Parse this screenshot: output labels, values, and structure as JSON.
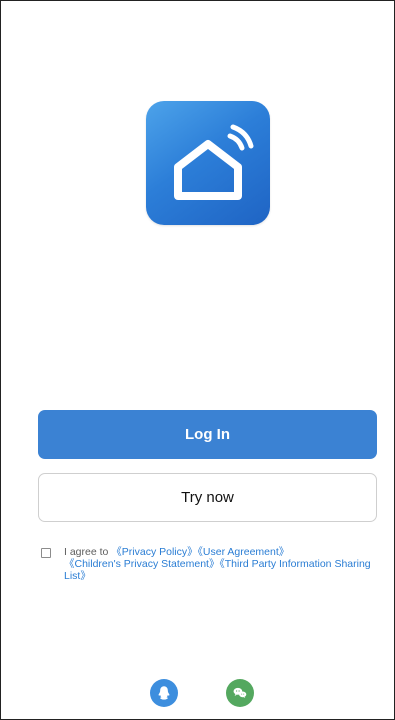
{
  "app": {
    "logo_icon": "smart-home-logo-icon"
  },
  "actions": {
    "login_label": "Log In",
    "try_now_label": "Try now"
  },
  "agreement": {
    "checked": false,
    "prefix": "I agree to ",
    "links": [
      "《Privacy Policy》",
      "《User Agreement》",
      "《Children's Privacy Statement》",
      "《Third Party Information Sharing List》"
    ]
  },
  "social": {
    "items": [
      "qq-icon",
      "wechat-icon"
    ]
  },
  "colors": {
    "primary": "#3b82d3",
    "link": "#2a7dd4",
    "qq": "#3d8ede",
    "wechat": "#54a85f"
  }
}
